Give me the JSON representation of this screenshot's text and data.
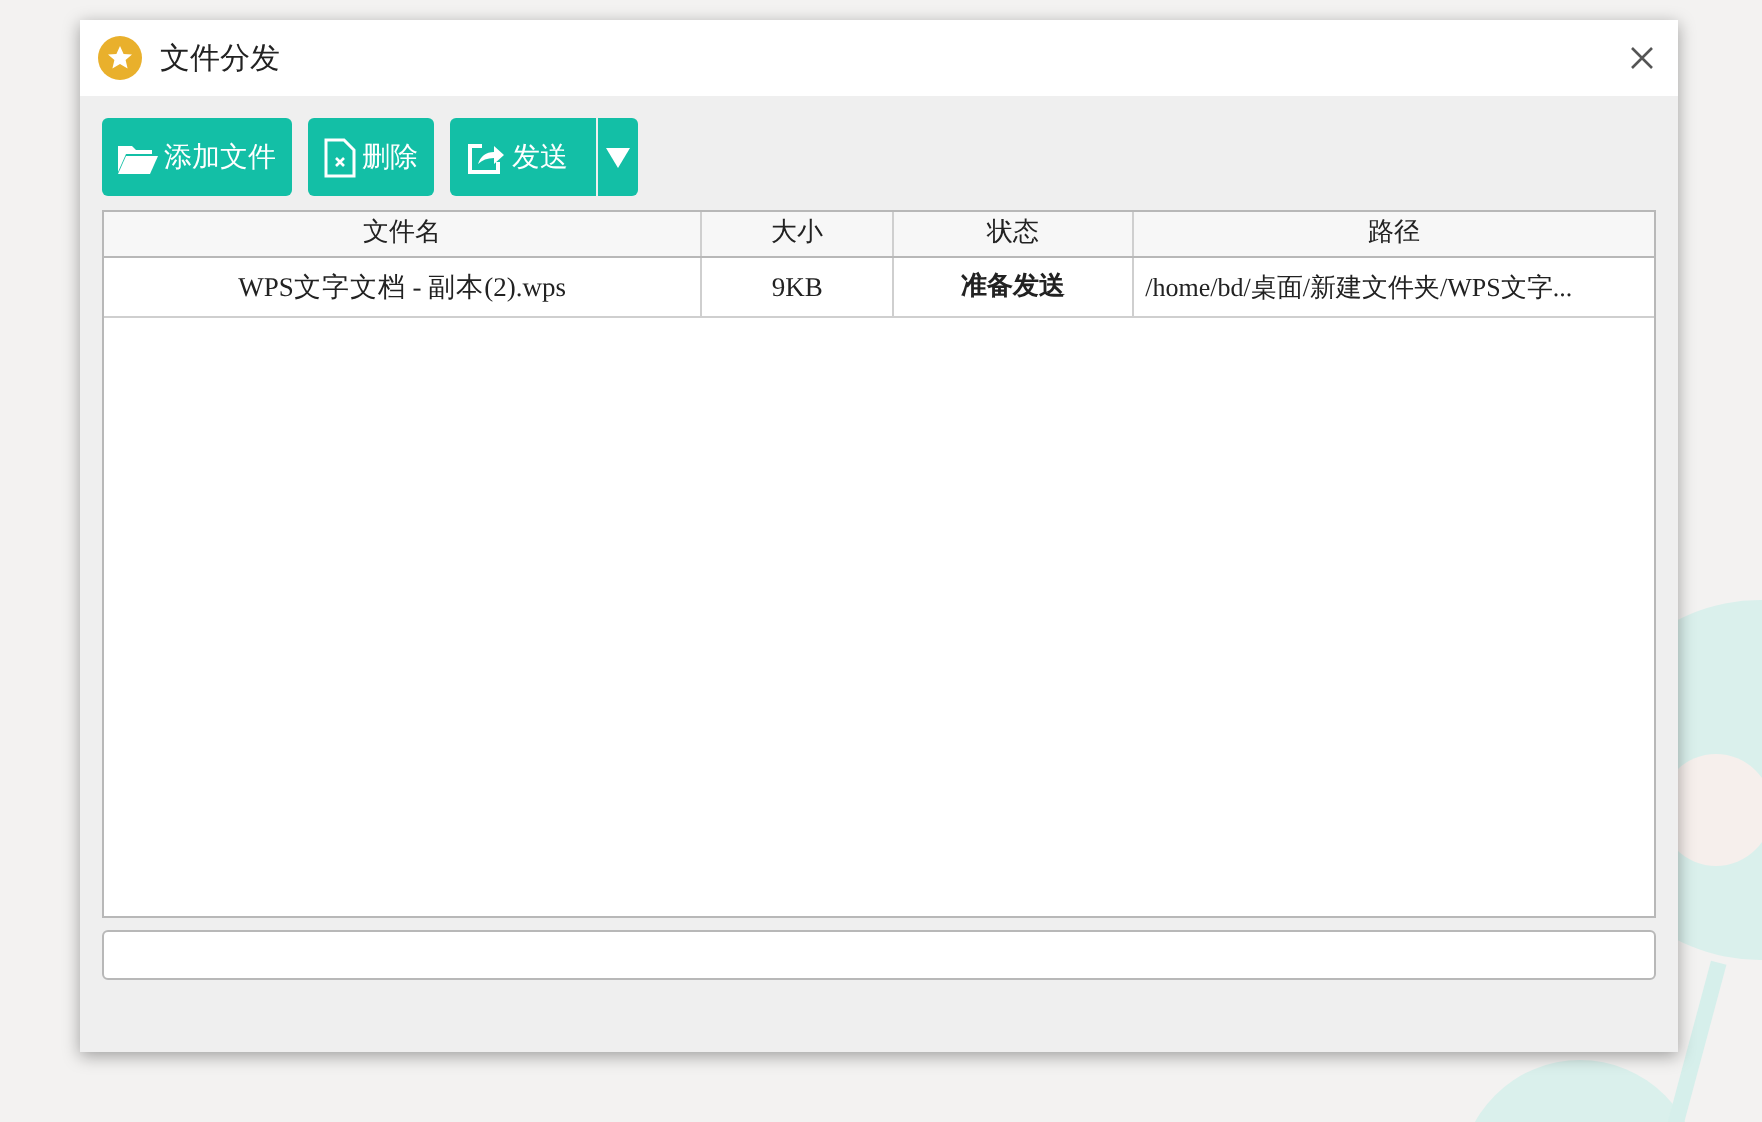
{
  "window": {
    "title": "文件分发"
  },
  "toolbar": [
    {
      "kind": "add",
      "label": "添加文件"
    },
    {
      "kind": "delete",
      "label": "删除"
    },
    {
      "kind": "send",
      "label": "发送"
    }
  ],
  "table": {
    "columns": [
      "文件名",
      "大小",
      "状态",
      "路径"
    ],
    "rows": [
      {
        "cells": [
          "WPS文字文档 - 副本(2).wps",
          "9KB",
          "准备发送",
          "/home/bd/桌面/新建文件夹/WPS文字..."
        ]
      }
    ]
  }
}
